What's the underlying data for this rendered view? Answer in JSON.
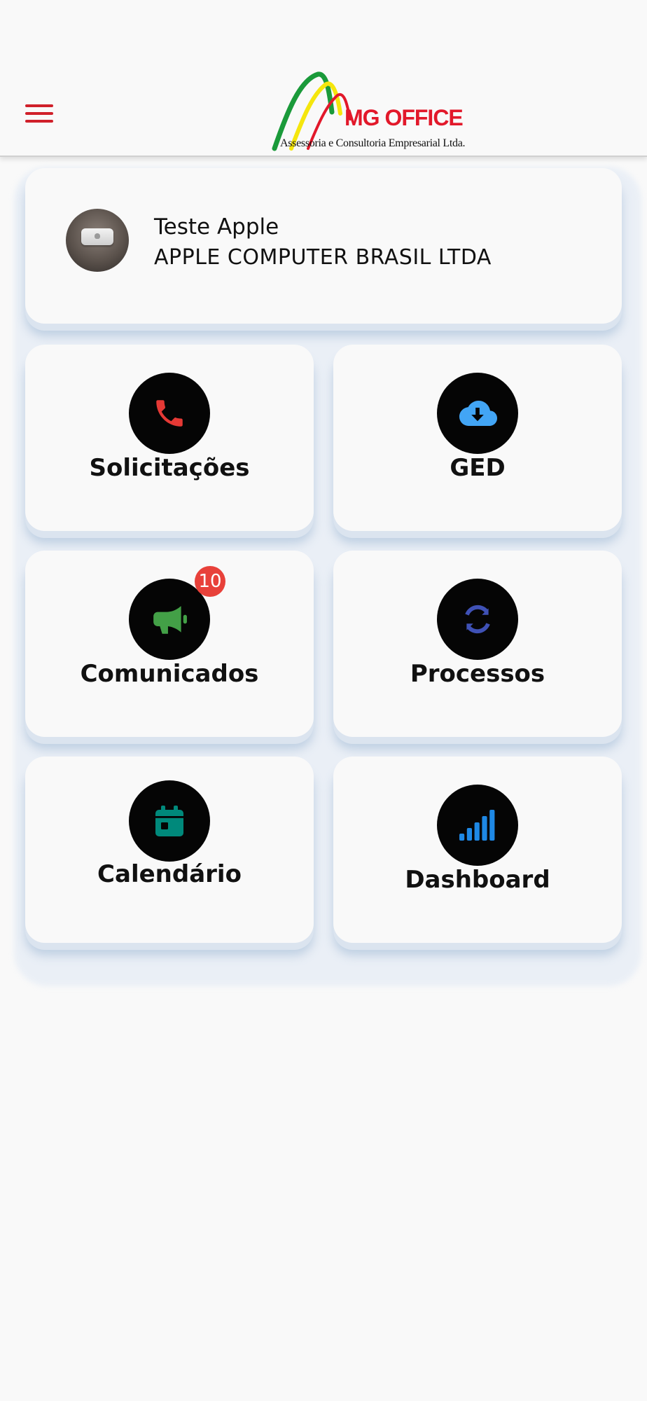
{
  "header": {
    "menu_icon": "hamburger-menu-icon",
    "logo": {
      "name": "MG OFFICE",
      "subtitle": "Assessoria e Consultoria Empresarial Ltda."
    }
  },
  "profile": {
    "name": "Teste Apple",
    "company": "APPLE COMPUTER BRASIL LTDA"
  },
  "tiles": [
    {
      "label": "Solicitações",
      "icon": "phone-icon",
      "icon_color": "#e53935"
    },
    {
      "label": "GED",
      "icon": "cloud-download-icon",
      "icon_color": "#42a5f5"
    },
    {
      "label": "Comunicados",
      "icon": "megaphone-icon",
      "icon_color": "#43a047",
      "badge": "10"
    },
    {
      "label": "Processos",
      "icon": "sync-icon",
      "icon_color": "#3f51b5"
    },
    {
      "label": "Calendário",
      "icon": "calendar-icon",
      "icon_color": "#00897b"
    },
    {
      "label": "Dashboard",
      "icon": "signal-bars-icon",
      "icon_color": "#1e88e5"
    }
  ],
  "colors": {
    "accent": "#e2182a",
    "badge": "#e8413a",
    "background": "#f9f9f9"
  }
}
